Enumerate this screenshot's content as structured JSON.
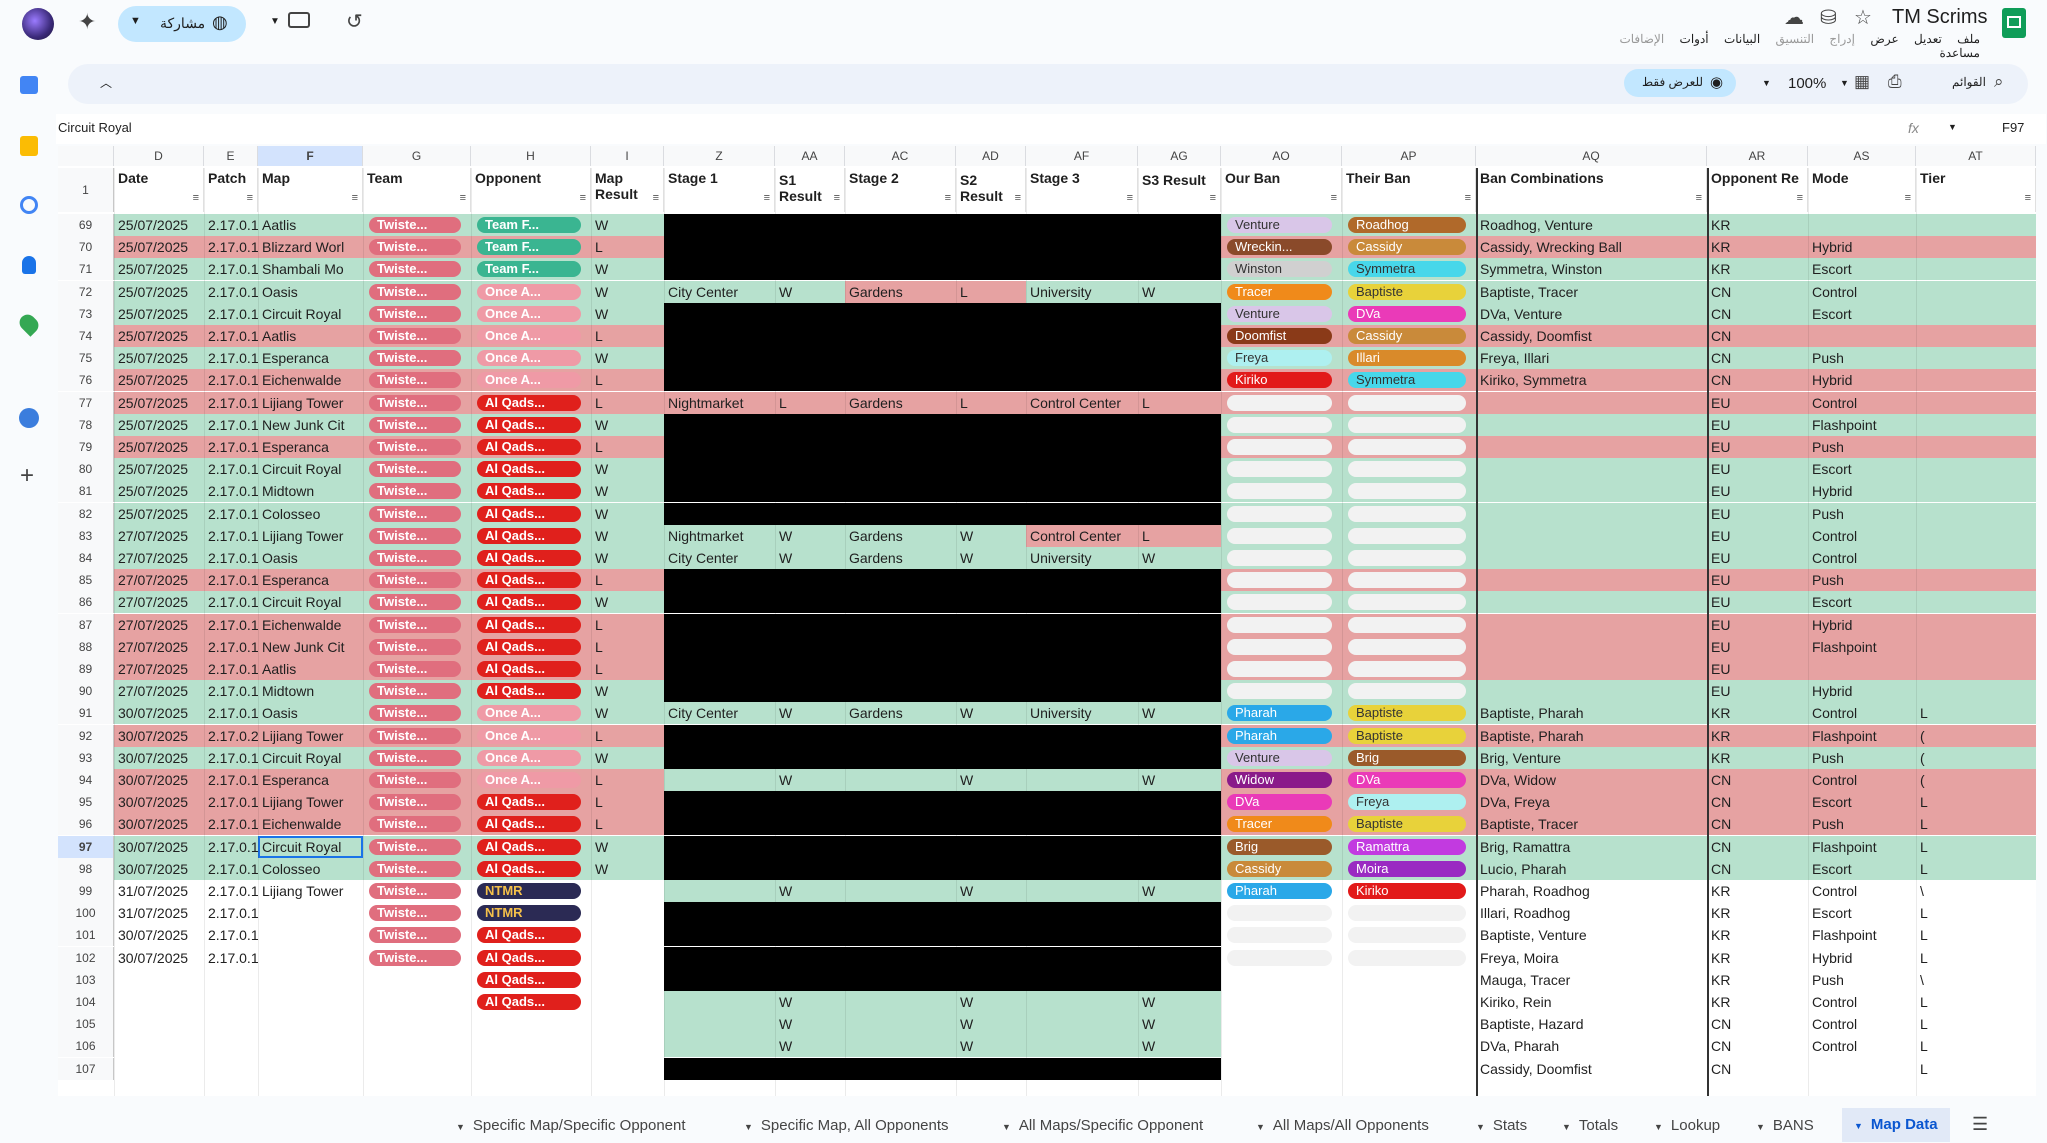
{
  "app": {
    "doc_title": "TM Scrims",
    "share_label": "مشاركة"
  },
  "menu": [
    "ملف",
    "تعديل",
    "عرض",
    "إدراج",
    "التنسيق",
    "البيانات",
    "أدوات",
    "الإضافات",
    "مساعدة"
  ],
  "toolbar": {
    "search_label": "القوائم",
    "zoom": "100%",
    "view_only_label": "للعرض فقط"
  },
  "formula": {
    "cell_ref": "F97",
    "value": "Circuit Royal",
    "fx": "fx"
  },
  "columns": [
    "D",
    "E",
    "F",
    "G",
    "H",
    "I",
    "Z",
    "AA",
    "AC",
    "AD",
    "AF",
    "AG",
    "AO",
    "AP",
    "AQ",
    "AR",
    "AS",
    "AT"
  ],
  "header_row_number": "1",
  "headers": [
    "Date",
    "Patch",
    "Map",
    "Team",
    "Opponent",
    "Map Result",
    "Stage 1",
    "S1 Result",
    "Stage 2",
    "S2 Result",
    "Stage 3",
    "S3 Result",
    "Our Ban",
    "Their Ban",
    "Ban Combinations",
    "Opponent Re",
    "Mode",
    "Tier"
  ],
  "rows": [
    {
      "n": "69",
      "date": "25/07/2025",
      "patch": "2.17.0.1",
      "map": "Aatlis",
      "team": "Twiste...",
      "opp": "Team F...",
      "res": "W",
      "s1": "",
      "r1": "",
      "s2": "",
      "r2": "",
      "s3": "",
      "r3": "",
      "our": "Venture",
      "their": "Roadhog",
      "ban": "Roadhog, Venture",
      "region": "KR",
      "mode": "",
      "tier": ""
    },
    {
      "n": "70",
      "date": "25/07/2025",
      "patch": "2.17.0.1",
      "map": "Blizzard Worl",
      "team": "Twiste...",
      "opp": "Team F...",
      "res": "L",
      "s1": "",
      "r1": "",
      "s2": "",
      "r2": "",
      "s3": "",
      "r3": "",
      "our": "Wreckin...",
      "their": "Cassidy",
      "ban": "Cassidy, Wrecking Ball",
      "region": "KR",
      "mode": "Hybrid",
      "tier": ""
    },
    {
      "n": "71",
      "date": "25/07/2025",
      "patch": "2.17.0.1",
      "map": "Shambali Mo",
      "team": "Twiste...",
      "opp": "Team F...",
      "res": "W",
      "s1": "",
      "r1": "",
      "s2": "",
      "r2": "",
      "s3": "",
      "r3": "",
      "our": "Winston",
      "their": "Symmetra",
      "ban": "Symmetra, Winston",
      "region": "KR",
      "mode": "Escort",
      "tier": ""
    },
    {
      "n": "72",
      "date": "25/07/2025",
      "patch": "2.17.0.1",
      "map": "Oasis",
      "team": "Twiste...",
      "opp": "Once A...",
      "res": "W",
      "s1": "City Center",
      "r1": "W",
      "s2": "Gardens",
      "r2": "L",
      "s3": "University",
      "r3": "W",
      "our": "Tracer",
      "their": "Baptiste",
      "ban": "Baptiste, Tracer",
      "region": "CN",
      "mode": "Control",
      "tier": ""
    },
    {
      "n": "73",
      "date": "25/07/2025",
      "patch": "2.17.0.1",
      "map": "Circuit Royal",
      "team": "Twiste...",
      "opp": "Once A...",
      "res": "W",
      "s1": "",
      "r1": "",
      "s2": "",
      "r2": "",
      "s3": "",
      "r3": "",
      "our": "Venture",
      "their": "DVa",
      "ban": "DVa, Venture",
      "region": "CN",
      "mode": "Escort",
      "tier": ""
    },
    {
      "n": "74",
      "date": "25/07/2025",
      "patch": "2.17.0.1",
      "map": "Aatlis",
      "team": "Twiste...",
      "opp": "Once A...",
      "res": "L",
      "s1": "",
      "r1": "",
      "s2": "",
      "r2": "",
      "s3": "",
      "r3": "",
      "our": "Doomfist",
      "their": "Cassidy",
      "ban": "Cassidy, Doomfist",
      "region": "CN",
      "mode": "",
      "tier": ""
    },
    {
      "n": "75",
      "date": "25/07/2025",
      "patch": "2.17.0.1",
      "map": "Esperanca",
      "team": "Twiste...",
      "opp": "Once A...",
      "res": "W",
      "s1": "",
      "r1": "",
      "s2": "",
      "r2": "",
      "s3": "",
      "r3": "",
      "our": "Freya",
      "their": "Illari",
      "ban": "Freya, Illari",
      "region": "CN",
      "mode": "Push",
      "tier": ""
    },
    {
      "n": "76",
      "date": "25/07/2025",
      "patch": "2.17.0.1",
      "map": "Eichenwalde",
      "team": "Twiste...",
      "opp": "Once A...",
      "res": "L",
      "s1": "",
      "r1": "",
      "s2": "",
      "r2": "",
      "s3": "",
      "r3": "",
      "our": "Kiriko",
      "their": "Symmetra",
      "ban": "Kiriko, Symmetra",
      "region": "CN",
      "mode": "Hybrid",
      "tier": ""
    },
    {
      "n": "77",
      "date": "25/07/2025",
      "patch": "2.17.0.1",
      "map": "Lijiang Tower",
      "team": "Twiste...",
      "opp": "Al Qads...",
      "res": "L",
      "s1": "Nightmarket",
      "r1": "L",
      "s2": "Gardens",
      "r2": "L",
      "s3": "Control Center",
      "r3": "L",
      "our": "",
      "their": "",
      "ban": "",
      "region": "EU",
      "mode": "Control",
      "tier": ""
    },
    {
      "n": "78",
      "date": "25/07/2025",
      "patch": "2.17.0.1",
      "map": "New Junk Cit",
      "team": "Twiste...",
      "opp": "Al Qads...",
      "res": "W",
      "s1": "",
      "r1": "",
      "s2": "",
      "r2": "",
      "s3": "",
      "r3": "",
      "our": "",
      "their": "",
      "ban": "",
      "region": "EU",
      "mode": "Flashpoint",
      "tier": ""
    },
    {
      "n": "79",
      "date": "25/07/2025",
      "patch": "2.17.0.1",
      "map": "Esperanca",
      "team": "Twiste...",
      "opp": "Al Qads...",
      "res": "L",
      "s1": "",
      "r1": "",
      "s2": "",
      "r2": "",
      "s3": "",
      "r3": "",
      "our": "",
      "their": "",
      "ban": "",
      "region": "EU",
      "mode": "Push",
      "tier": ""
    },
    {
      "n": "80",
      "date": "25/07/2025",
      "patch": "2.17.0.1",
      "map": "Circuit Royal",
      "team": "Twiste...",
      "opp": "Al Qads...",
      "res": "W",
      "s1": "",
      "r1": "",
      "s2": "",
      "r2": "",
      "s3": "",
      "r3": "",
      "our": "",
      "their": "",
      "ban": "",
      "region": "EU",
      "mode": "Escort",
      "tier": ""
    },
    {
      "n": "81",
      "date": "25/07/2025",
      "patch": "2.17.0.1",
      "map": "Midtown",
      "team": "Twiste...",
      "opp": "Al Qads...",
      "res": "W",
      "s1": "",
      "r1": "",
      "s2": "",
      "r2": "",
      "s3": "",
      "r3": "",
      "our": "",
      "their": "",
      "ban": "",
      "region": "EU",
      "mode": "Hybrid",
      "tier": ""
    },
    {
      "n": "82",
      "date": "25/07/2025",
      "patch": "2.17.0.1",
      "map": "Colosseo",
      "team": "Twiste...",
      "opp": "Al Qads...",
      "res": "W",
      "s1": "",
      "r1": "",
      "s2": "",
      "r2": "",
      "s3": "",
      "r3": "",
      "our": "",
      "their": "",
      "ban": "",
      "region": "EU",
      "mode": "Push",
      "tier": ""
    },
    {
      "n": "83",
      "date": "27/07/2025",
      "patch": "2.17.0.1",
      "map": "Lijiang Tower",
      "team": "Twiste...",
      "opp": "Al Qads...",
      "res": "W",
      "s1": "Nightmarket",
      "r1": "W",
      "s2": "Gardens",
      "r2": "W",
      "s3": "Control Center",
      "r3": "L",
      "our": "",
      "their": "",
      "ban": "",
      "region": "EU",
      "mode": "Control",
      "tier": ""
    },
    {
      "n": "84",
      "date": "27/07/2025",
      "patch": "2.17.0.1",
      "map": "Oasis",
      "team": "Twiste...",
      "opp": "Al Qads...",
      "res": "W",
      "s1": "City Center",
      "r1": "W",
      "s2": "Gardens",
      "r2": "W",
      "s3": "University",
      "r3": "W",
      "our": "",
      "their": "",
      "ban": "",
      "region": "EU",
      "mode": "Control",
      "tier": ""
    },
    {
      "n": "85",
      "date": "27/07/2025",
      "patch": "2.17.0.1",
      "map": "Esperanca",
      "team": "Twiste...",
      "opp": "Al Qads...",
      "res": "L",
      "s1": "",
      "r1": "",
      "s2": "",
      "r2": "",
      "s3": "",
      "r3": "",
      "our": "",
      "their": "",
      "ban": "",
      "region": "EU",
      "mode": "Push",
      "tier": ""
    },
    {
      "n": "86",
      "date": "27/07/2025",
      "patch": "2.17.0.1",
      "map": "Circuit Royal",
      "team": "Twiste...",
      "opp": "Al Qads...",
      "res": "W",
      "s1": "",
      "r1": "",
      "s2": "",
      "r2": "",
      "s3": "",
      "r3": "",
      "our": "",
      "their": "",
      "ban": "",
      "region": "EU",
      "mode": "Escort",
      "tier": ""
    },
    {
      "n": "87",
      "date": "27/07/2025",
      "patch": "2.17.0.1",
      "map": "Eichenwalde",
      "team": "Twiste...",
      "opp": "Al Qads...",
      "res": "L",
      "s1": "",
      "r1": "",
      "s2": "",
      "r2": "",
      "s3": "",
      "r3": "",
      "our": "",
      "their": "",
      "ban": "",
      "region": "EU",
      "mode": "Hybrid",
      "tier": ""
    },
    {
      "n": "88",
      "date": "27/07/2025",
      "patch": "2.17.0.1",
      "map": "New Junk Cit",
      "team": "Twiste...",
      "opp": "Al Qads...",
      "res": "L",
      "s1": "",
      "r1": "",
      "s2": "",
      "r2": "",
      "s3": "",
      "r3": "",
      "our": "",
      "their": "",
      "ban": "",
      "region": "EU",
      "mode": "Flashpoint",
      "tier": ""
    },
    {
      "n": "89",
      "date": "27/07/2025",
      "patch": "2.17.0.1",
      "map": "Aatlis",
      "team": "Twiste...",
      "opp": "Al Qads...",
      "res": "L",
      "s1": "",
      "r1": "",
      "s2": "",
      "r2": "",
      "s3": "",
      "r3": "",
      "our": "",
      "their": "",
      "ban": "",
      "region": "EU",
      "mode": "",
      "tier": ""
    },
    {
      "n": "90",
      "date": "27/07/2025",
      "patch": "2.17.0.1",
      "map": "Midtown",
      "team": "Twiste...",
      "opp": "Al Qads...",
      "res": "W",
      "s1": "",
      "r1": "",
      "s2": "",
      "r2": "",
      "s3": "",
      "r3": "",
      "our": "",
      "their": "",
      "ban": "",
      "region": "EU",
      "mode": "Hybrid",
      "tier": ""
    },
    {
      "n": "91",
      "date": "30/07/2025",
      "patch": "2.17.0.1",
      "map": "Oasis",
      "team": "Twiste...",
      "opp": "Once A...",
      "res": "W",
      "s1": "City Center",
      "r1": "W",
      "s2": "Gardens",
      "r2": "W",
      "s3": "University",
      "r3": "W",
      "our": "Pharah",
      "their": "Baptiste",
      "ban": "Baptiste, Pharah",
      "region": "KR",
      "mode": "Control",
      "tier": "L"
    },
    {
      "n": "92",
      "date": "30/07/2025",
      "patch": "2.17.0.2",
      "map": "Lijiang Tower",
      "team": "Twiste...",
      "opp": "Once A...",
      "res": "L",
      "s1": "",
      "r1": "",
      "s2": "",
      "r2": "",
      "s3": "",
      "r3": "",
      "our": "Pharah",
      "their": "Baptiste",
      "ban": "Baptiste, Pharah",
      "region": "KR",
      "mode": "Flashpoint",
      "tier": "("
    },
    {
      "n": "93",
      "date": "30/07/2025",
      "patch": "2.17.0.1",
      "map": "Circuit Royal",
      "team": "Twiste...",
      "opp": "Once A...",
      "res": "W",
      "s1": "",
      "r1": "",
      "s2": "",
      "r2": "",
      "s3": "",
      "r3": "",
      "our": "Venture",
      "their": "Brig",
      "ban": "Brig, Venture",
      "region": "KR",
      "mode": "Push",
      "tier": "("
    },
    {
      "n": "94",
      "date": "30/07/2025",
      "patch": "2.17.0.1",
      "map": "Esperanca",
      "team": "Twiste...",
      "opp": "Once A...",
      "res": "L",
      "s1": "",
      "r1": "W",
      "s2": "",
      "r2": "W",
      "s3": "",
      "r3": "W",
      "our": "Widow",
      "their": "DVa",
      "ban": "DVa, Widow",
      "region": "CN",
      "mode": "Control",
      "tier": "("
    },
    {
      "n": "95",
      "date": "30/07/2025",
      "patch": "2.17.0.1",
      "map": "Lijiang Tower",
      "team": "Twiste...",
      "opp": "Al Qads...",
      "res": "L",
      "s1": "",
      "r1": "",
      "s2": "",
      "r2": "",
      "s3": "",
      "r3": "",
      "our": "DVa",
      "their": "Freya",
      "ban": "DVa, Freya",
      "region": "CN",
      "mode": "Escort",
      "tier": "L"
    },
    {
      "n": "96",
      "date": "30/07/2025",
      "patch": "2.17.0.1",
      "map": "Eichenwalde",
      "team": "Twiste...",
      "opp": "Al Qads...",
      "res": "L",
      "s1": "",
      "r1": "",
      "s2": "",
      "r2": "",
      "s3": "",
      "r3": "",
      "our": "Tracer",
      "their": "Baptiste",
      "ban": "Baptiste, Tracer",
      "region": "CN",
      "mode": "Push",
      "tier": "L"
    },
    {
      "n": "97",
      "date": "30/07/2025",
      "patch": "2.17.0.1",
      "map": "Circuit Royal",
      "team": "Twiste...",
      "opp": "Al Qads...",
      "res": "W",
      "s1": "",
      "r1": "",
      "s2": "",
      "r2": "",
      "s3": "",
      "r3": "",
      "our": "Brig",
      "their": "Ramattra",
      "ban": "Brig, Ramattra",
      "region": "CN",
      "mode": "Flashpoint",
      "tier": "L"
    },
    {
      "n": "98",
      "date": "30/07/2025",
      "patch": "2.17.0.1",
      "map": "Colosseo",
      "team": "Twiste...",
      "opp": "Al Qads...",
      "res": "W",
      "s1": "",
      "r1": "",
      "s2": "",
      "r2": "",
      "s3": "",
      "r3": "",
      "our": "Cassidy",
      "their": "Moira",
      "ban": "Lucio, Pharah",
      "region": "CN",
      "mode": "Escort",
      "tier": "L"
    },
    {
      "n": "99",
      "date": "31/07/2025",
      "patch": "2.17.0.1",
      "map": "Lijiang Tower",
      "team": "Twiste...",
      "opp": "NTMR",
      "res": "",
      "s1": "",
      "r1": "W",
      "s2": "",
      "r2": "W",
      "s3": "",
      "r3": "W",
      "our": "Pharah",
      "their": "Kiriko",
      "ban": "Pharah, Roadhog",
      "region": "KR",
      "mode": "Control",
      "tier": "\\"
    },
    {
      "n": "100",
      "date": "31/07/2025",
      "patch": "2.17.0.1",
      "map": "",
      "team": "Twiste...",
      "opp": "NTMR",
      "res": "",
      "s1": "",
      "r1": "",
      "s2": "",
      "r2": "",
      "s3": "",
      "r3": "",
      "our": "",
      "their": "",
      "ban": "Illari, Roadhog",
      "region": "KR",
      "mode": "Escort",
      "tier": "L"
    },
    {
      "n": "101",
      "date": "30/07/2025",
      "patch": "2.17.0.1",
      "map": "",
      "team": "Twiste...",
      "opp": "Al Qads...",
      "res": "",
      "s1": "",
      "r1": "",
      "s2": "",
      "r2": "",
      "s3": "",
      "r3": "",
      "our": "",
      "their": "",
      "ban": "Baptiste, Venture",
      "region": "KR",
      "mode": "Flashpoint",
      "tier": "L"
    },
    {
      "n": "102",
      "date": "30/07/2025",
      "patch": "2.17.0.1",
      "map": "",
      "team": "Twiste...",
      "opp": "Al Qads...",
      "res": "",
      "s1": "",
      "r1": "",
      "s2": "",
      "r2": "",
      "s3": "",
      "r3": "",
      "our": "",
      "their": "",
      "ban": "Freya, Moira",
      "region": "KR",
      "mode": "Hybrid",
      "tier": "L"
    },
    {
      "n": "103",
      "date": "",
      "patch": "",
      "map": "",
      "team": "",
      "opp": "Al Qads...",
      "res": "",
      "s1": "",
      "r1": "",
      "s2": "",
      "r2": "",
      "s3": "",
      "r3": "",
      "our": "",
      "their": "",
      "ban": "Mauga, Tracer",
      "region": "KR",
      "mode": "Push",
      "tier": "\\"
    },
    {
      "n": "104",
      "date": "",
      "patch": "",
      "map": "",
      "team": "",
      "opp": "Al Qads...",
      "res": "",
      "s1": "",
      "r1": "W",
      "s2": "",
      "r2": "W",
      "s3": "",
      "r3": "W",
      "our": "",
      "their": "",
      "ban": "Kiriko, Rein",
      "region": "KR",
      "mode": "Control",
      "tier": "L"
    },
    {
      "n": "105",
      "date": "",
      "patch": "",
      "map": "",
      "team": "",
      "opp": "",
      "res": "",
      "s1": "",
      "r1": "W",
      "s2": "",
      "r2": "W",
      "s3": "",
      "r3": "W",
      "our": "",
      "their": "",
      "ban": "Baptiste, Hazard",
      "region": "CN",
      "mode": "Control",
      "tier": "L"
    },
    {
      "n": "106",
      "date": "",
      "patch": "",
      "map": "",
      "team": "",
      "opp": "",
      "res": "",
      "s1": "",
      "r1": "W",
      "s2": "",
      "r2": "W",
      "s3": "",
      "r3": "W",
      "our": "",
      "their": "",
      "ban": "DVa, Pharah",
      "region": "CN",
      "mode": "Control",
      "tier": "L"
    },
    {
      "n": "107",
      "date": "",
      "patch": "",
      "map": "",
      "team": "",
      "opp": "",
      "res": "",
      "s1": "",
      "r1": "",
      "s2": "",
      "r2": "",
      "s3": "",
      "r3": "",
      "our": "",
      "their": "",
      "ban": "Cassidy, Doomfist",
      "region": "CN",
      "mode": "",
      "tier": "L"
    }
  ],
  "sheet_tabs": [
    "Specific Map/Specific Opponent",
    "Specific Map, All Opponents",
    "All Maps/Specific Opponent",
    "All Maps/All Opponents",
    "Stats",
    "Totals",
    "Lookup",
    "BANS",
    "Map Data"
  ],
  "active_tab": "Map Data",
  "colors": {
    "win": "#b7e1cd",
    "loss": "#e6a2a2",
    "black": "#000000",
    "team_chip": "#e06e7e",
    "alqads_chip": "#e0201c",
    "once_chip": "#ef9aa6",
    "teamf_chip": "#3ab591",
    "ntmr_chip": "#2b2a54"
  },
  "hero_colors": {
    "Venture": "#d9c6e8",
    "Roadhog": "#b0692a",
    "Wreckin...": "#8a4a2a",
    "Cassidy": "#c98a3a",
    "Winston": "#d0d0d0",
    "Symmetra": "#47d7ea",
    "Tracer": "#f08a1a",
    "Baptiste": "#e8d23a",
    "DVa": "#ea3ab8",
    "Doomfist": "#8a3a18",
    "Freya": "#aef0f0",
    "Illari": "#d98a2a",
    "Kiriko": "#e21a1a",
    "Pharah": "#2aa8e8",
    "Brig": "#9a5a2a",
    "Widow": "#8a1a8a",
    "Ramattra": "#c23ae0",
    "Moira": "#9a2ac2"
  }
}
